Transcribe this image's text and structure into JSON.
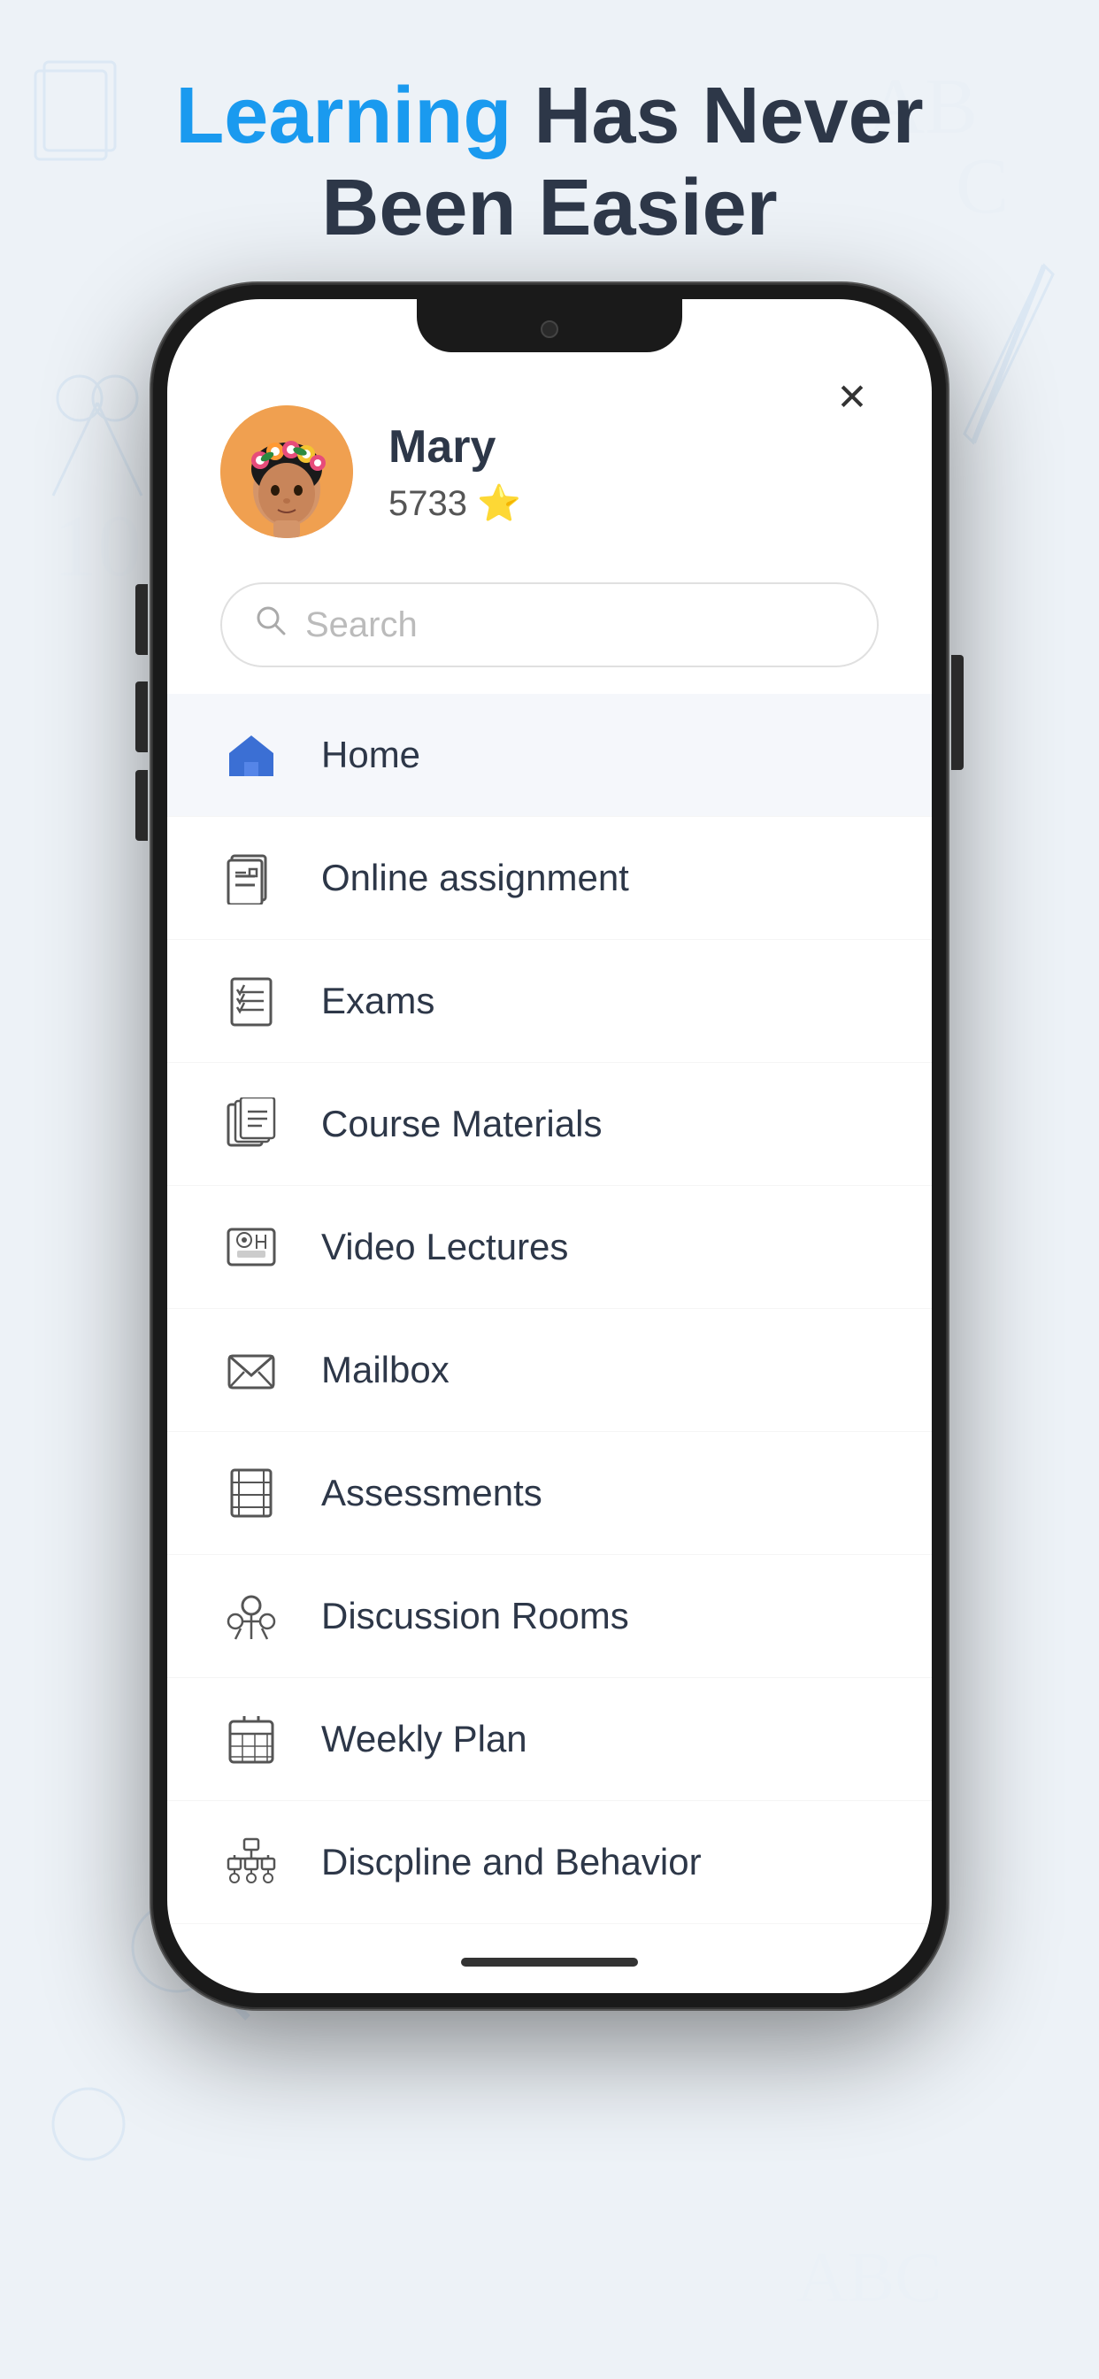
{
  "header": {
    "line1_blue": "Learning",
    "line1_rest": " Has Never",
    "line2": "Been Easier"
  },
  "profile": {
    "name": "Mary",
    "points": "5733",
    "star": "⭐"
  },
  "search": {
    "placeholder": "Search"
  },
  "close_button": "✕",
  "menu_items": [
    {
      "id": "home",
      "label": "Home",
      "active": true
    },
    {
      "id": "online-assignment",
      "label": "Online assignment",
      "active": false
    },
    {
      "id": "exams",
      "label": "Exams",
      "active": false
    },
    {
      "id": "course-materials",
      "label": "Course Materials",
      "active": false
    },
    {
      "id": "video-lectures",
      "label": "Video Lectures",
      "active": false
    },
    {
      "id": "mailbox",
      "label": "Mailbox",
      "active": false
    },
    {
      "id": "assessments",
      "label": "Assessments",
      "active": false
    },
    {
      "id": "discussion-rooms",
      "label": "Discussion Rooms",
      "active": false
    },
    {
      "id": "weekly-plan",
      "label": "Weekly Plan",
      "active": false
    },
    {
      "id": "discipline-behavior",
      "label": "Discpline and Behavior",
      "active": false
    }
  ],
  "colors": {
    "blue_accent": "#1a9aef",
    "dark_text": "#2d3748",
    "icon_gray": "#666"
  }
}
